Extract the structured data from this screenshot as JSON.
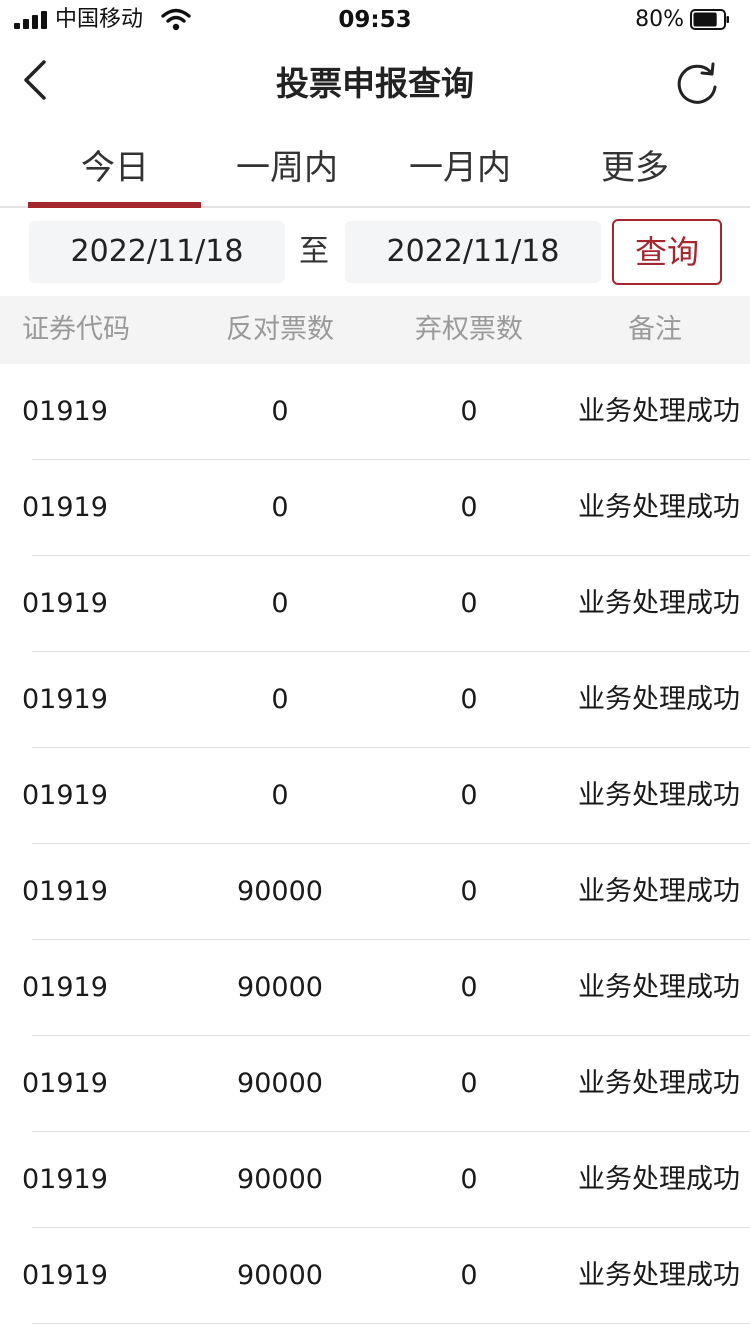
{
  "status_bar": {
    "carrier": "中国移动",
    "time": "09:53",
    "battery": "80%",
    "battery_level": 0.8
  },
  "nav": {
    "title": "投票申报查询",
    "back_icon": "chevron-left-icon",
    "refresh_icon": "refresh-icon"
  },
  "tabs": [
    {
      "label": "今日",
      "active": true
    },
    {
      "label": "一周内",
      "active": false
    },
    {
      "label": "一月内",
      "active": false
    },
    {
      "label": "更多",
      "active": false
    }
  ],
  "query": {
    "start_date": "2022/11/18",
    "separator": "至",
    "end_date": "2022/11/18",
    "button_label": "查询"
  },
  "table": {
    "headers": [
      "证券代码",
      "反对票数",
      "弃权票数",
      "备注"
    ],
    "rows": [
      [
        "01919",
        "0",
        "0",
        "业务处理成功"
      ],
      [
        "01919",
        "0",
        "0",
        "业务处理成功"
      ],
      [
        "01919",
        "0",
        "0",
        "业务处理成功"
      ],
      [
        "01919",
        "0",
        "0",
        "业务处理成功"
      ],
      [
        "01919",
        "0",
        "0",
        "业务处理成功"
      ],
      [
        "01919",
        "90000",
        "0",
        "业务处理成功"
      ],
      [
        "01919",
        "90000",
        "0",
        "业务处理成功"
      ],
      [
        "01919",
        "90000",
        "0",
        "业务处理成功"
      ],
      [
        "01919",
        "90000",
        "0",
        "业务处理成功"
      ],
      [
        "01919",
        "90000",
        "0",
        "业务处理成功"
      ]
    ]
  },
  "colors": {
    "accent": "#a3272d",
    "header_bg": "#f4f4f5",
    "date_box_bg": "#f4f5f7"
  }
}
